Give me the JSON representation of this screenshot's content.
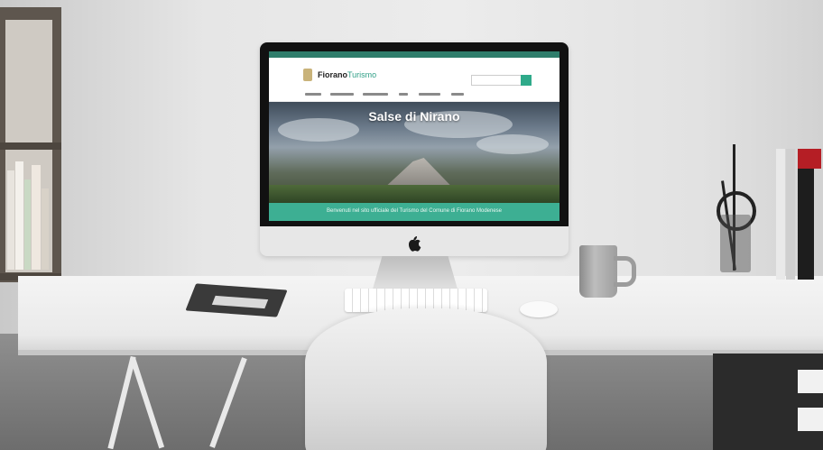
{
  "scene": {
    "description_icons": [
      "computer-monitor-icon",
      "apple-logo-icon",
      "keyboard-icon",
      "mouse-icon",
      "mug-icon",
      "chair-icon",
      "notebook-icon",
      "pen-cup-icon",
      "books-icon",
      "shelf-icon"
    ]
  },
  "website": {
    "logo_bold": "Fiorano",
    "logo_light": "Turismo",
    "search_placeholder": "",
    "hero_title": "Salse di Nirano",
    "welcome_text": "Benvenuti nel sito ufficiale del Turismo del Comune di Fiorano Modenese"
  },
  "colors": {
    "site_accent": "#3daf93",
    "site_topbar": "#2f7d6b"
  }
}
